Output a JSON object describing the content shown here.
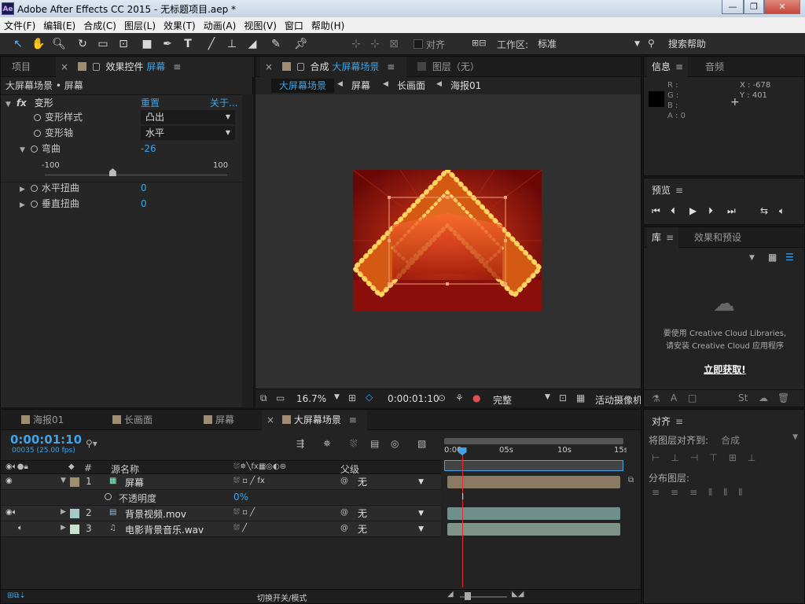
{
  "window": {
    "logo": "Ae",
    "title": "Adobe After Effects CC 2015 - 无标题项目.aep *",
    "min": "—",
    "max": "❐",
    "close": "✕"
  },
  "menu": [
    "文件(F)",
    "编辑(E)",
    "合成(C)",
    "图层(L)",
    "效果(T)",
    "动画(A)",
    "视图(V)",
    "窗口",
    "帮助(H)"
  ],
  "toolbar": {
    "align_label": "对齐",
    "workspace_label": "工作区:",
    "workspace_value": "标准",
    "search_help": "搜索帮助"
  },
  "left_panel": {
    "tab_project": "项目",
    "tab_effects": "效果控件",
    "tab_effects_layer": "屏幕",
    "breadcrumb": "大屏幕场景 • 屏幕",
    "effect_name": "变形",
    "reset": "重置",
    "about": "关于...",
    "props": {
      "style_label": "变形样式",
      "style_value": "凸出",
      "axis_label": "变形轴",
      "axis_value": "水平",
      "bend_label": "弯曲",
      "bend_value": "-26",
      "bend_fraction": 0.37,
      "slider_min": "-100",
      "slider_max": "100",
      "hdist_label": "水平扭曲",
      "hdist_value": "0",
      "vdist_label": "垂直扭曲",
      "vdist_value": "0"
    }
  },
  "comp_panel": {
    "tab_comp": "合成",
    "tab_comp_name": "大屏幕场景",
    "tab_layer": "图层（无）",
    "crumbs": [
      "大屏幕场景",
      "屏幕",
      "长画面",
      "海报01"
    ],
    "zoom": "16.7%",
    "timecode": "0:00:01:10",
    "resolution": "完整",
    "camera": "活动摄像机"
  },
  "info_panel": {
    "tab_info": "信息",
    "tab_audio": "音频",
    "r": "R :",
    "g": "G :",
    "b": "B :",
    "a": "A : 0",
    "x": "X : -678",
    "y": "Y : 401"
  },
  "preview_panel": {
    "title": "预览"
  },
  "library_panel": {
    "tab_lib": "库",
    "tab_effects": "效果和预设",
    "msg1": "要使用 Creative Cloud Libraries,",
    "msg2": "请安装 Creative Cloud 应用程序",
    "link": "立即获取!"
  },
  "timeline": {
    "tabs": [
      "海报01",
      "长画面",
      "屏幕",
      "大屏幕场景"
    ],
    "timecode": "0:00:01:10",
    "frames": "00035 (25.00 fps)",
    "col_hash": "#",
    "col_source": "源名称",
    "col_parent": "父级",
    "ruler": [
      "0:00s",
      "05s",
      "10s",
      "15s"
    ],
    "playhead_fraction": 0.09,
    "layers": [
      {
        "num": "1",
        "name": "屏幕",
        "parent": "无"
      },
      {
        "num": "2",
        "name": "背景视频.mov",
        "parent": "无"
      },
      {
        "num": "3",
        "name": "电影背景音乐.wav",
        "parent": "无"
      }
    ],
    "opacity_label": "不透明度",
    "opacity_value": "0%",
    "toggle_label": "切换开关/模式"
  },
  "align_panel": {
    "title": "对齐",
    "align_to_label": "将图层对齐到:",
    "align_to_value": "合成",
    "distribute_label": "分布图层:"
  },
  "colors": {
    "accent": "#3ea3e8",
    "layer1": "#a08c70",
    "layer2": "#a7c9c3",
    "layer3": "#c9e0d0"
  }
}
